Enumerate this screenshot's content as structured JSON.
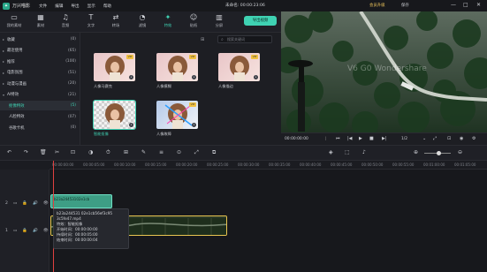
{
  "app": {
    "title": "万兴喵影",
    "doc_title": "未命名: 00:00:23:06",
    "upgrade": "会员升级",
    "save_label": "保存",
    "logo_glyph": "✦"
  },
  "menu": [
    "文件",
    "编辑",
    "导出",
    "显示",
    "帮助"
  ],
  "window_controls": [
    "—",
    "□",
    "✕"
  ],
  "tabs": [
    {
      "label": "我的素材",
      "icon": "folder-icon",
      "glyph": "▭"
    },
    {
      "label": "素材",
      "icon": "sticker-icon",
      "glyph": "▦"
    },
    {
      "label": "音频",
      "icon": "music-icon",
      "glyph": "♫"
    },
    {
      "label": "文字",
      "icon": "text-icon",
      "glyph": "T"
    },
    {
      "label": "转场",
      "icon": "transition-icon",
      "glyph": "⇄"
    },
    {
      "label": "滤镜",
      "icon": "filter-icon",
      "glyph": "◔"
    },
    {
      "label": "特效",
      "icon": "effects-icon",
      "glyph": "✦",
      "active": true
    },
    {
      "label": "贴纸",
      "icon": "sticker-face-icon",
      "glyph": "☺"
    },
    {
      "label": "分屏",
      "icon": "split-screen-icon",
      "glyph": "▥"
    }
  ],
  "export_label": "导出视频",
  "sidebar": [
    {
      "name": "收藏",
      "count": "(0)",
      "star": true
    },
    {
      "name": "最近使用",
      "count": "(65)"
    },
    {
      "name": "推荐",
      "count": "(100)"
    },
    {
      "name": "电影氛围",
      "count": "(51)"
    },
    {
      "name": "动漫与漫画",
      "count": "(20)"
    },
    {
      "name": "AI特效",
      "count": "(21)",
      "expanded": true
    },
    {
      "name": "抠像特效",
      "count": "(5)",
      "sub": true,
      "selected": true
    },
    {
      "name": "人脸特效",
      "count": "(07)",
      "sub": true
    },
    {
      "name": "谷歌卡机",
      "count": "(0)",
      "sub": true
    }
  ],
  "search": {
    "placeholder": "搜索关键词"
  },
  "effects": [
    {
      "label": "人像马赛克",
      "vip": true
    },
    {
      "label": "人像模糊",
      "vip": true
    },
    {
      "label": "人像描边",
      "vip": true
    },
    {
      "label": "智能抠像",
      "vip": false,
      "selected": true
    },
    {
      "label": "人像故障",
      "vip": true
    }
  ],
  "vip_badge": "VIP",
  "download_glyph": "↓",
  "preview": {
    "watermark": "V6 G0 Wondershare",
    "timecode": "00:00:00:00",
    "page": "1/2",
    "controls": [
      "⏮",
      "|◀",
      "▶",
      "■",
      "▶|"
    ]
  },
  "toolbar_icons": [
    "↶",
    "↷",
    "🗑",
    "✂",
    "⊡",
    "◑",
    "⏱",
    "⊞",
    "✎",
    "≡",
    "⊙",
    "⤢",
    "⧉",
    "◈",
    "⬚",
    "♪",
    "⊕",
    "⊖"
  ],
  "ruler": [
    "00:00:00:00",
    "00:00:05:00",
    "00:00:10:00",
    "00:00:15:00",
    "00:00:20:00",
    "00:00:25:00",
    "00:00:30:00",
    "00:00:35:00",
    "00:00:40:00",
    "00:00:45:00",
    "00:00:50:00",
    "00:00:55:00",
    "00:01:00:00",
    "00:01:05:00"
  ],
  "tracks": [
    {
      "num": "2",
      "icons": [
        "▭",
        "🔒",
        "🔊",
        "👁"
      ]
    },
    {
      "num": "1",
      "icons": [
        "▭",
        "🔒",
        "🔊",
        "👁"
      ]
    }
  ],
  "clip1_label": "b23a24453102e1cb",
  "tooltip": [
    "b23a244531 02e1cb56ef3c95",
    "3c5fe47.mp4",
    "特效：智能抠像",
    "开始时间：00:00:00:00",
    "持续时间：00:00:05:00",
    "结束时间：00:00:00:04"
  ]
}
